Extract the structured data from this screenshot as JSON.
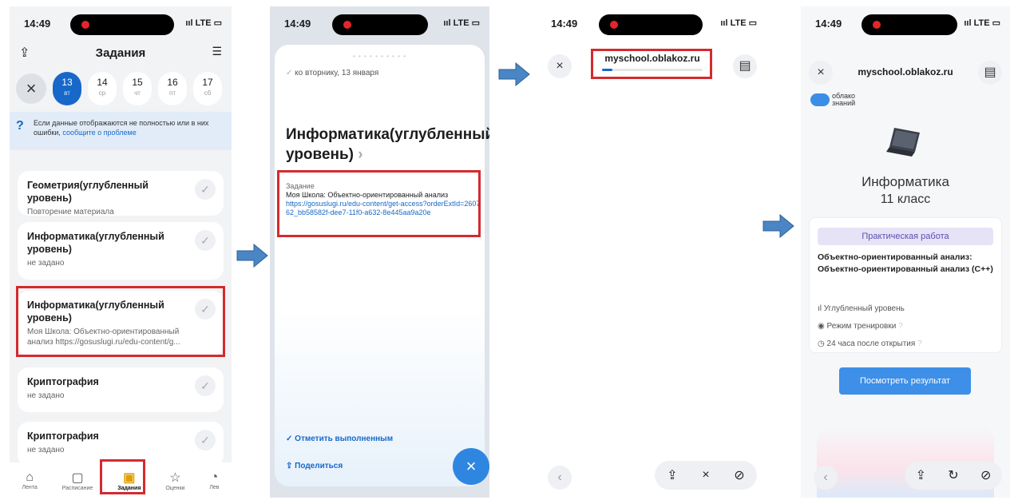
{
  "status": {
    "time": "14:49",
    "signal": "LTE"
  },
  "screen1": {
    "title": "Задания",
    "dates": [
      {
        "day": "13",
        "weekday": "вт"
      },
      {
        "day": "14",
        "weekday": "ср"
      },
      {
        "day": "15",
        "weekday": "чт"
      },
      {
        "day": "16",
        "weekday": "пт"
      },
      {
        "day": "17",
        "weekday": "сб"
      }
    ],
    "banner_text": "Если данные отображаются не полностью или в них ошибки,",
    "banner_link": "сообщите о проблеме",
    "cards": [
      {
        "title": "Геометрия(углубленный уровень)",
        "subtitle": "Повторение материала"
      },
      {
        "title": "Информатика(углубленный уровень)",
        "subtitle": "не задано"
      },
      {
        "title": "Информатика(углубленный уровень)",
        "subtitle": "Моя Школа: Объектно-ориентированный анализ https://gosuslugi.ru/edu-content/g..."
      },
      {
        "title": "Криптография",
        "subtitle": "не задано"
      },
      {
        "title": "Криптография",
        "subtitle": "не задано"
      }
    ],
    "tabs": [
      "Лента",
      "Расписание",
      "Задания",
      "Оценки",
      "Лев"
    ]
  },
  "screen2": {
    "due": "ко вторнику, 13 января",
    "subject": "Информатика(углубленный уровень)",
    "task_label": "Задание",
    "task_text": "Моя Школа: Объектно-ориентированный анализ",
    "task_link": "https://gosuslugi.ru/edu-content/get-access?orderExtId=260762_bb58582f-dee7-11f0-a632-8e445aa9a20e",
    "mark_done": "Отметить выполненным",
    "share": "Поделиться"
  },
  "screen3": {
    "url": "myschool.oblakoz.ru",
    "progress": 0.1
  },
  "screen4": {
    "url": "myschool.oblakoz.ru",
    "logo_line1": "облако",
    "logo_line2": "знаний",
    "subject": "Информатика",
    "grade": "11 класс",
    "badge": "Практическая работа",
    "work_title": "Объектно-ориентированный анализ: Объектно-ориентированный анализ (C++)",
    "level": "Углубленный уровень",
    "mode": "Режим тренировки",
    "time": "24 часа после открытия",
    "button": "Посмотреть результат"
  },
  "colors": {
    "accent": "#1768c8",
    "highlight": "#d42a2e",
    "arrow": "#4a86c5"
  }
}
